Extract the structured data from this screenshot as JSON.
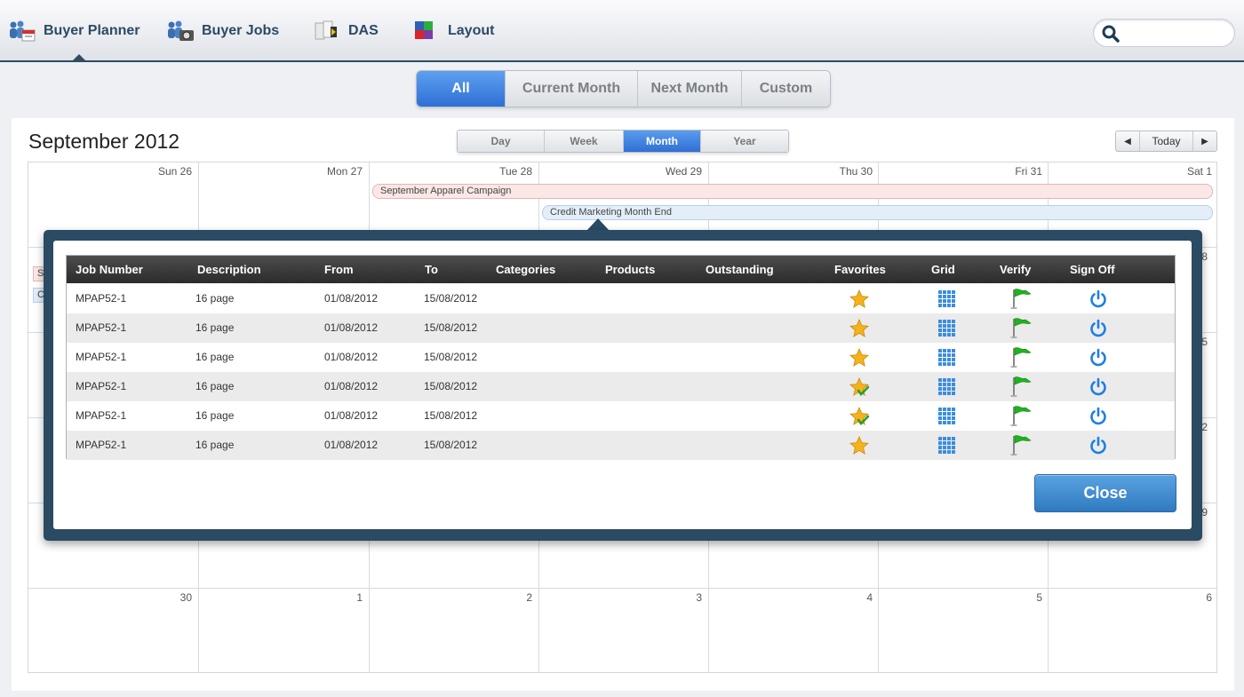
{
  "nav": {
    "items": [
      {
        "label": "Buyer Planner",
        "icon": "people-calendar-icon"
      },
      {
        "label": "Buyer Jobs",
        "icon": "people-camera-icon"
      },
      {
        "label": "DAS",
        "icon": "document-scanner-icon"
      },
      {
        "label": "Layout",
        "icon": "color-squares-icon"
      }
    ],
    "active": "Buyer Planner",
    "search_placeholder": ""
  },
  "period_filter": {
    "options": [
      "All",
      "Current Month",
      "Next Month",
      "Custom"
    ],
    "selected": "All"
  },
  "calendar": {
    "title": "September 2012",
    "views": [
      "Day",
      "Week",
      "Month",
      "Year"
    ],
    "selected_view": "Month",
    "today_label": "Today",
    "prev_label": "◀",
    "next_label": "▶",
    "header_days": [
      "Sun 26",
      "Mon 27",
      "Tue 28",
      "Wed 29",
      "Thu 30",
      "Fri 31",
      "Sat 1"
    ],
    "visible_right_numbers": [
      "8",
      "15",
      "22",
      "29"
    ],
    "last_row_days": [
      "30",
      "1",
      "2",
      "3",
      "4",
      "5",
      "6"
    ],
    "events": [
      {
        "title": "September Apparel Campaign",
        "color": "#fbe7e6"
      },
      {
        "title": "Credit Marketing Month End",
        "color": "#e3eef9"
      }
    ],
    "left_stubs": [
      "S",
      "C"
    ]
  },
  "jobs_popup": {
    "columns": [
      "Job Number",
      "Description",
      "From",
      "To",
      "Categories",
      "Products",
      "Outstanding",
      "Favorites",
      "Grid",
      "Verify",
      "Sign Off"
    ],
    "rows": [
      {
        "job": "MPAP52-1",
        "desc": "16 page",
        "from": "01/08/2012",
        "to": "15/08/2012",
        "favorite": "star-icon"
      },
      {
        "job": "MPAP52-1",
        "desc": "16 page",
        "from": "01/08/2012",
        "to": "15/08/2012",
        "favorite": "star-icon"
      },
      {
        "job": "MPAP52-1",
        "desc": "16 page",
        "from": "01/08/2012",
        "to": "15/08/2012",
        "favorite": "star-icon"
      },
      {
        "job": "MPAP52-1",
        "desc": "16 page",
        "from": "01/08/2012",
        "to": "15/08/2012",
        "favorite": "star-check-icon"
      },
      {
        "job": "MPAP52-1",
        "desc": "16 page",
        "from": "01/08/2012",
        "to": "15/08/2012",
        "favorite": "star-check-icon"
      },
      {
        "job": "MPAP52-1",
        "desc": "16 page",
        "from": "01/08/2012",
        "to": "15/08/2012",
        "favorite": "star-icon"
      }
    ],
    "close_label": "Close"
  },
  "colors": {
    "accent": "#2e6fd6",
    "nav_text": "#2b4a66",
    "popup_frame": "#2b4a63",
    "flag_green": "#1db51d",
    "power_blue": "#1e7fe0",
    "star_gold": "#f5b21a"
  }
}
